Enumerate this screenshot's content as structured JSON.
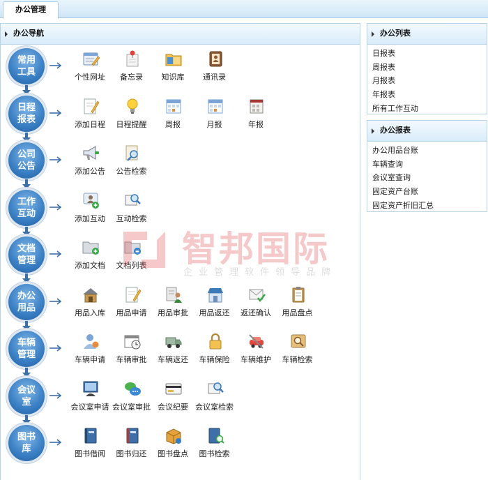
{
  "top_tab": {
    "label": "办公管理"
  },
  "nav_panel": {
    "title": "办公导航"
  },
  "rows": [
    {
      "name": "常用工具",
      "items": [
        "个性网址",
        "备忘录",
        "知识库",
        "通讯录"
      ]
    },
    {
      "name": "日程报表",
      "items": [
        "添加日程",
        "日程提醒",
        "周报",
        "月报",
        "年报"
      ]
    },
    {
      "name": "公司公告",
      "items": [
        "添加公告",
        "公告检索"
      ]
    },
    {
      "name": "工作互动",
      "items": [
        "添加互动",
        "互动检索"
      ]
    },
    {
      "name": "文档管理",
      "items": [
        "添加文档",
        "文档列表"
      ]
    },
    {
      "name": "办公用品",
      "items": [
        "用品入库",
        "用品申请",
        "用品审批",
        "用品返还",
        "返还确认",
        "用品盘点"
      ]
    },
    {
      "name": "车辆管理",
      "items": [
        "车辆申请",
        "车辆审批",
        "车辆返还",
        "车辆保险",
        "车辆维护",
        "车辆检索"
      ]
    },
    {
      "name": "会议室",
      "items": [
        "会议室申请",
        "会议室审批",
        "会议纪要",
        "会议室检索"
      ]
    },
    {
      "name": "图书库",
      "items": [
        "图书借阅",
        "图书归还",
        "图书盘点",
        "图书检索"
      ]
    }
  ],
  "office_list": {
    "title": "办公列表",
    "items": [
      "日报表",
      "周报表",
      "月报表",
      "年报表",
      "所有工作互动"
    ]
  },
  "office_reports": {
    "title": "办公报表",
    "items": [
      "办公用品台账",
      "车辆查询",
      "会议室查询",
      "固定资产台账",
      "固定资产折旧汇总"
    ]
  },
  "watermark": {
    "brand": "智邦国际",
    "tagline": "企业管理软件领导品牌"
  },
  "colors": {
    "accent_blue": "#3d82c6",
    "header_bg": "#d9ecf9",
    "border": "#b7d3e8",
    "watermark_red": "#e25d5d"
  }
}
